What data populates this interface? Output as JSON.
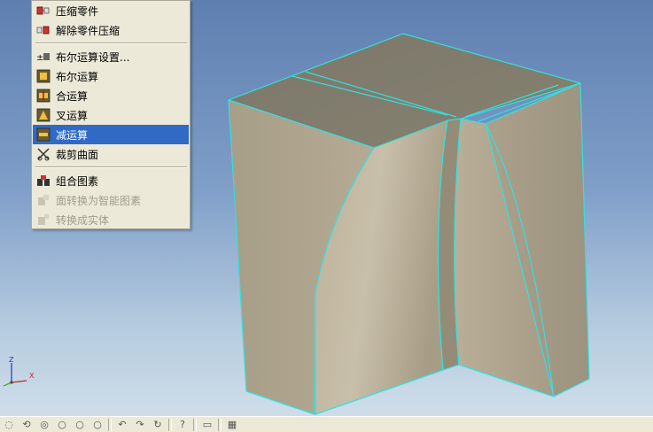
{
  "menu": {
    "items": [
      {
        "label": "压缩零件",
        "icon": "compress-part-icon",
        "state": "normal"
      },
      {
        "label": "解除零件压缩",
        "icon": "decompress-part-icon",
        "state": "normal"
      },
      {
        "label": "布尔运算设置...",
        "icon": "boolean-settings-icon",
        "state": "normal"
      },
      {
        "label": "布尔运算",
        "icon": "boolean-icon",
        "state": "normal"
      },
      {
        "label": "合运算",
        "icon": "union-icon",
        "state": "normal"
      },
      {
        "label": "叉运算",
        "icon": "intersect-icon",
        "state": "normal"
      },
      {
        "label": "减运算",
        "icon": "subtract-icon",
        "state": "selected"
      },
      {
        "label": "裁剪曲面",
        "icon": "trim-surface-icon",
        "state": "normal"
      },
      {
        "label": "组合图素",
        "icon": "group-shapes-icon",
        "state": "normal"
      },
      {
        "label": "面转换为智能图素",
        "icon": "face-to-smart-shape-icon",
        "state": "disabled"
      },
      {
        "label": "转换成实体",
        "icon": "convert-to-solid-icon",
        "state": "disabled"
      }
    ]
  },
  "axis": {
    "z_label": "Z",
    "x_label": "X"
  },
  "colors": {
    "selection": "#316ac5",
    "edge_highlight": "#33e0e0",
    "solid_face": "#b2a993"
  }
}
